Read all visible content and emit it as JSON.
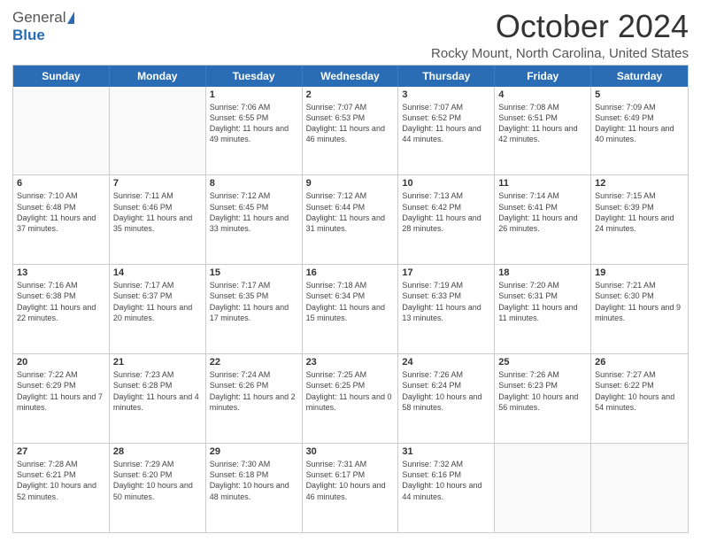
{
  "header": {
    "logo_general": "General",
    "logo_blue": "Blue",
    "month_title": "October 2024",
    "location": "Rocky Mount, North Carolina, United States"
  },
  "calendar": {
    "days_of_week": [
      "Sunday",
      "Monday",
      "Tuesday",
      "Wednesday",
      "Thursday",
      "Friday",
      "Saturday"
    ],
    "weeks": [
      [
        {
          "day": "",
          "empty": true
        },
        {
          "day": "",
          "empty": true
        },
        {
          "day": "1",
          "sunrise": "7:06 AM",
          "sunset": "6:55 PM",
          "daylight": "11 hours and 49 minutes."
        },
        {
          "day": "2",
          "sunrise": "7:07 AM",
          "sunset": "6:53 PM",
          "daylight": "11 hours and 46 minutes."
        },
        {
          "day": "3",
          "sunrise": "7:07 AM",
          "sunset": "6:52 PM",
          "daylight": "11 hours and 44 minutes."
        },
        {
          "day": "4",
          "sunrise": "7:08 AM",
          "sunset": "6:51 PM",
          "daylight": "11 hours and 42 minutes."
        },
        {
          "day": "5",
          "sunrise": "7:09 AM",
          "sunset": "6:49 PM",
          "daylight": "11 hours and 40 minutes."
        }
      ],
      [
        {
          "day": "6",
          "sunrise": "7:10 AM",
          "sunset": "6:48 PM",
          "daylight": "11 hours and 37 minutes."
        },
        {
          "day": "7",
          "sunrise": "7:11 AM",
          "sunset": "6:46 PM",
          "daylight": "11 hours and 35 minutes."
        },
        {
          "day": "8",
          "sunrise": "7:12 AM",
          "sunset": "6:45 PM",
          "daylight": "11 hours and 33 minutes."
        },
        {
          "day": "9",
          "sunrise": "7:12 AM",
          "sunset": "6:44 PM",
          "daylight": "11 hours and 31 minutes."
        },
        {
          "day": "10",
          "sunrise": "7:13 AM",
          "sunset": "6:42 PM",
          "daylight": "11 hours and 28 minutes."
        },
        {
          "day": "11",
          "sunrise": "7:14 AM",
          "sunset": "6:41 PM",
          "daylight": "11 hours and 26 minutes."
        },
        {
          "day": "12",
          "sunrise": "7:15 AM",
          "sunset": "6:39 PM",
          "daylight": "11 hours and 24 minutes."
        }
      ],
      [
        {
          "day": "13",
          "sunrise": "7:16 AM",
          "sunset": "6:38 PM",
          "daylight": "11 hours and 22 minutes."
        },
        {
          "day": "14",
          "sunrise": "7:17 AM",
          "sunset": "6:37 PM",
          "daylight": "11 hours and 20 minutes."
        },
        {
          "day": "15",
          "sunrise": "7:17 AM",
          "sunset": "6:35 PM",
          "daylight": "11 hours and 17 minutes."
        },
        {
          "day": "16",
          "sunrise": "7:18 AM",
          "sunset": "6:34 PM",
          "daylight": "11 hours and 15 minutes."
        },
        {
          "day": "17",
          "sunrise": "7:19 AM",
          "sunset": "6:33 PM",
          "daylight": "11 hours and 13 minutes."
        },
        {
          "day": "18",
          "sunrise": "7:20 AM",
          "sunset": "6:31 PM",
          "daylight": "11 hours and 11 minutes."
        },
        {
          "day": "19",
          "sunrise": "7:21 AM",
          "sunset": "6:30 PM",
          "daylight": "11 hours and 9 minutes."
        }
      ],
      [
        {
          "day": "20",
          "sunrise": "7:22 AM",
          "sunset": "6:29 PM",
          "daylight": "11 hours and 7 minutes."
        },
        {
          "day": "21",
          "sunrise": "7:23 AM",
          "sunset": "6:28 PM",
          "daylight": "11 hours and 4 minutes."
        },
        {
          "day": "22",
          "sunrise": "7:24 AM",
          "sunset": "6:26 PM",
          "daylight": "11 hours and 2 minutes."
        },
        {
          "day": "23",
          "sunrise": "7:25 AM",
          "sunset": "6:25 PM",
          "daylight": "11 hours and 0 minutes."
        },
        {
          "day": "24",
          "sunrise": "7:26 AM",
          "sunset": "6:24 PM",
          "daylight": "10 hours and 58 minutes."
        },
        {
          "day": "25",
          "sunrise": "7:26 AM",
          "sunset": "6:23 PM",
          "daylight": "10 hours and 56 minutes."
        },
        {
          "day": "26",
          "sunrise": "7:27 AM",
          "sunset": "6:22 PM",
          "daylight": "10 hours and 54 minutes."
        }
      ],
      [
        {
          "day": "27",
          "sunrise": "7:28 AM",
          "sunset": "6:21 PM",
          "daylight": "10 hours and 52 minutes."
        },
        {
          "day": "28",
          "sunrise": "7:29 AM",
          "sunset": "6:20 PM",
          "daylight": "10 hours and 50 minutes."
        },
        {
          "day": "29",
          "sunrise": "7:30 AM",
          "sunset": "6:18 PM",
          "daylight": "10 hours and 48 minutes."
        },
        {
          "day": "30",
          "sunrise": "7:31 AM",
          "sunset": "6:17 PM",
          "daylight": "10 hours and 46 minutes."
        },
        {
          "day": "31",
          "sunrise": "7:32 AM",
          "sunset": "6:16 PM",
          "daylight": "10 hours and 44 minutes."
        },
        {
          "day": "",
          "empty": true
        },
        {
          "day": "",
          "empty": true
        }
      ]
    ]
  }
}
